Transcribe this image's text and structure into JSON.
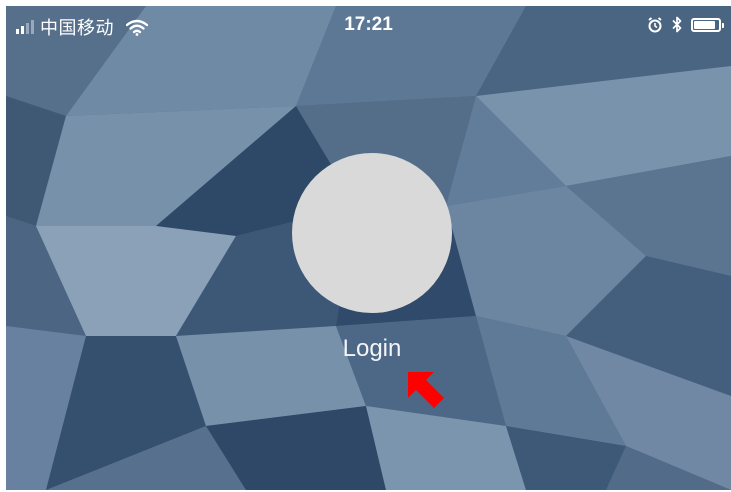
{
  "status_bar": {
    "carrier": "中国移动",
    "time": "17:21",
    "battery_level": 0.8,
    "icons": [
      "signal-icon",
      "wifi-icon",
      "alarm-icon",
      "bluetooth-icon",
      "battery-icon"
    ]
  },
  "main": {
    "login_label": "Login",
    "avatar_color": "#d9d9d9"
  },
  "annotation": {
    "arrow_color": "#ff0000",
    "arrow_icon": "arrow-pointer-icon"
  },
  "theme": {
    "background": "#4c6783"
  }
}
